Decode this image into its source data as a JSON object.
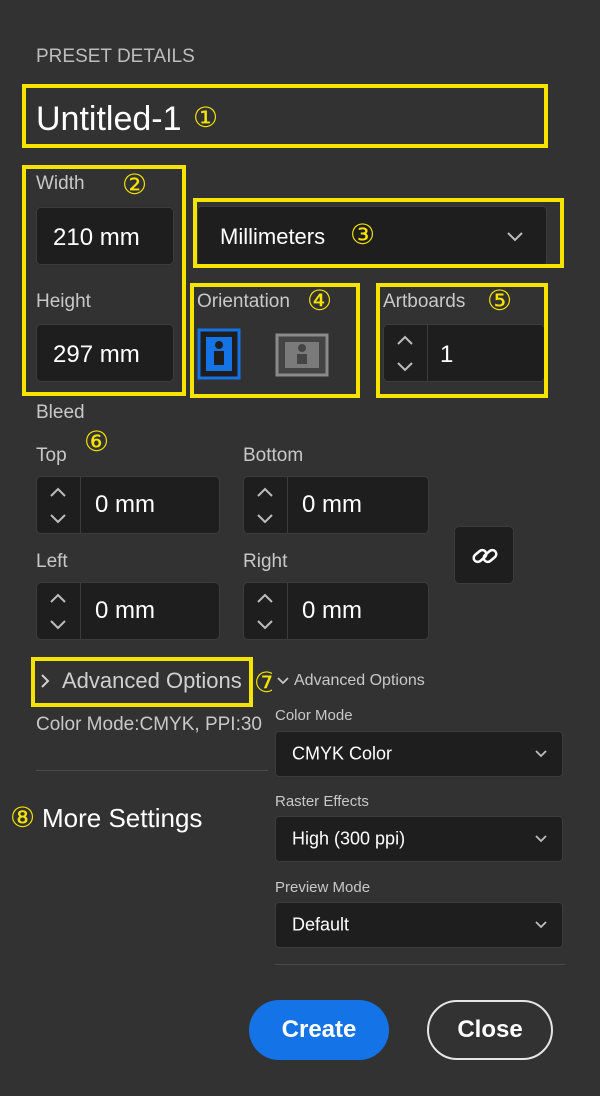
{
  "header": {
    "section_title": "PRESET DETAILS"
  },
  "preset": {
    "name": "Untitled-1"
  },
  "size": {
    "width_label": "Width",
    "width_value": "210 mm",
    "height_label": "Height",
    "height_value": "297 mm",
    "units_value": "Millimeters"
  },
  "orientation": {
    "label": "Orientation",
    "selected": "portrait"
  },
  "artboards": {
    "label": "Artboards",
    "value": "1"
  },
  "bleed": {
    "label": "Bleed",
    "top_label": "Top",
    "top_value": "0 mm",
    "bottom_label": "Bottom",
    "bottom_value": "0 mm",
    "left_label": "Left",
    "left_value": "0 mm",
    "right_label": "Right",
    "right_value": "0 mm"
  },
  "advanced": {
    "toggle_label": "Advanced Options",
    "summary": "Color Mode:CMYK, PPI:30",
    "popup_title": "Advanced Options",
    "color_mode_label": "Color Mode",
    "color_mode_value": "CMYK Color",
    "raster_label": "Raster Effects",
    "raster_value": "High (300 ppi)",
    "preview_label": "Preview Mode",
    "preview_value": "Default"
  },
  "more_settings": {
    "label": "More Settings"
  },
  "actions": {
    "create_label": "Create",
    "close_label": "Close"
  },
  "annotations": {
    "n1": "①",
    "n2": "②",
    "n3": "③",
    "n4": "④",
    "n5": "⑤",
    "n6": "⑥",
    "n7": "⑦",
    "n8": "⑧"
  },
  "colors": {
    "background": "#323232",
    "field": "#1e1e1e",
    "accent_blue": "#1473e6",
    "highlight_yellow": "#f5e400"
  }
}
